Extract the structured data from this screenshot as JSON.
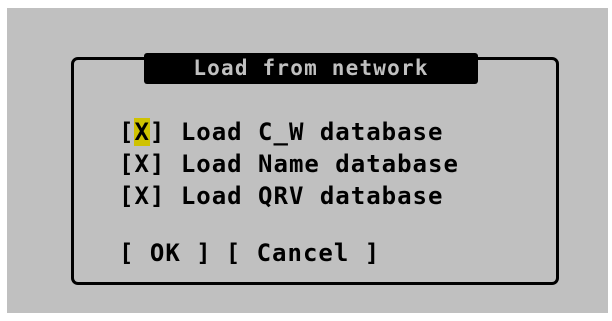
{
  "dialog": {
    "title": "Load from network",
    "options": [
      {
        "bracket_open": "[",
        "mark": "X",
        "bracket_close": "]",
        "label": "Load C_W database",
        "checked": true,
        "focused": true
      },
      {
        "bracket_open": "[",
        "mark": "X",
        "bracket_close": "]",
        "label": "Load Name database",
        "checked": true,
        "focused": false
      },
      {
        "bracket_open": "[",
        "mark": "X",
        "bracket_close": "]",
        "label": "Load QRV database",
        "checked": true,
        "focused": false
      }
    ],
    "buttons": {
      "ok_label": "[ OK ]",
      "cancel_label": "[ Cancel ]"
    }
  },
  "colors": {
    "screen_bg": "#c0c0c0",
    "frame": "#000000",
    "title_bg": "#000000",
    "title_fg": "#c0c0c0",
    "focus_highlight": "#cfc200"
  }
}
